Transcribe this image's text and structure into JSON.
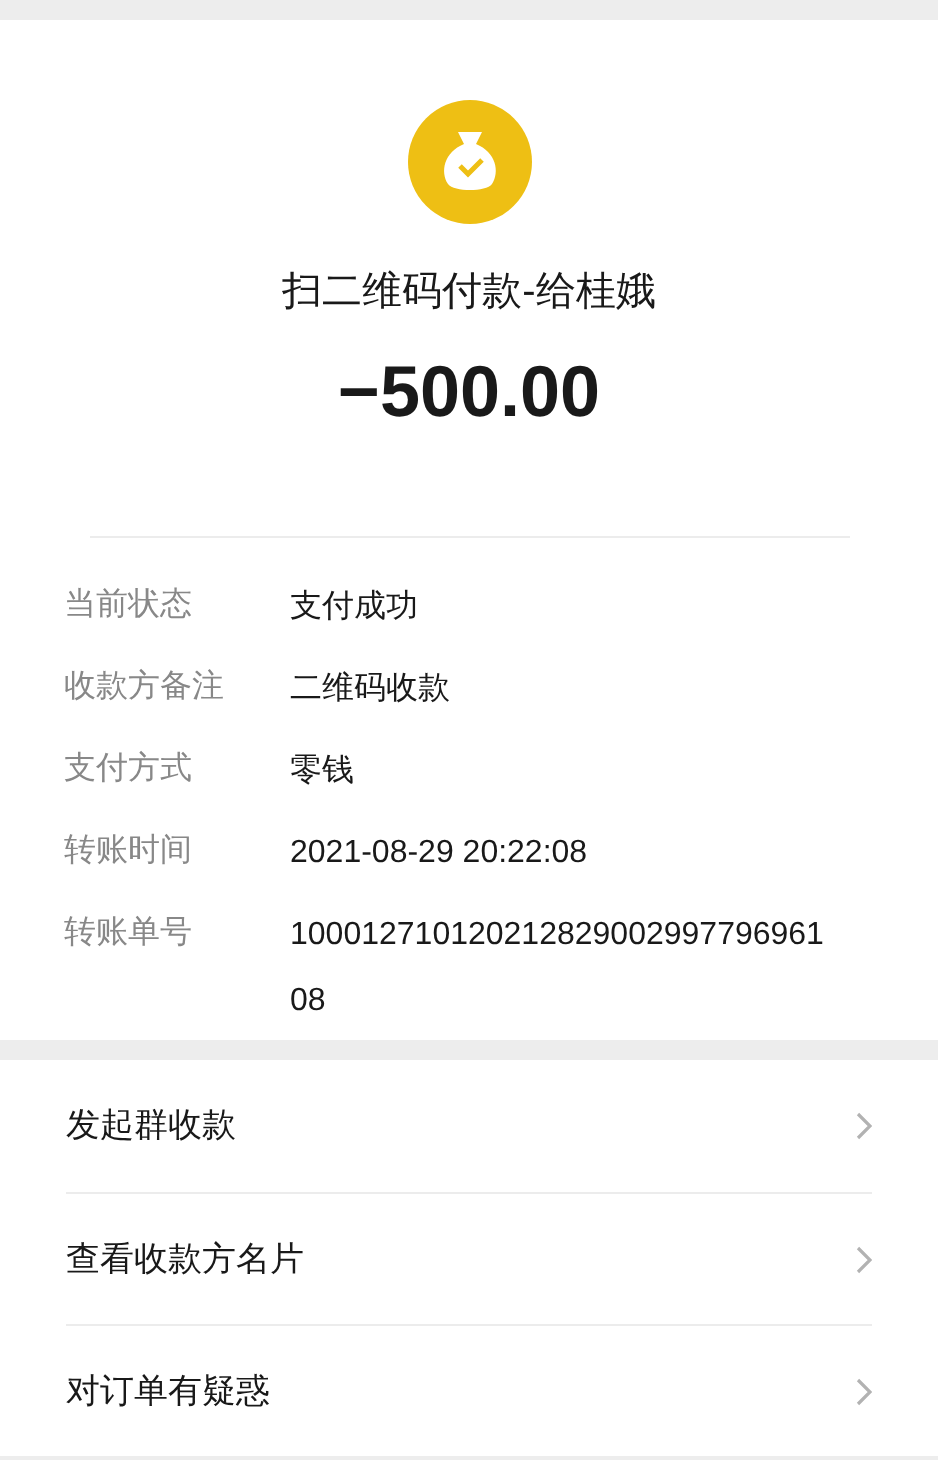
{
  "receipt": {
    "title": "扫二维码付款-给桂娥",
    "amount": "−500.00"
  },
  "details": [
    {
      "label": "当前状态",
      "value": "支付成功"
    },
    {
      "label": "收款方备注",
      "value": "二维码收款"
    },
    {
      "label": "支付方式",
      "value": "零钱"
    },
    {
      "label": "转账时间",
      "value": "2021-08-29 20:22:08"
    },
    {
      "label": "转账单号",
      "value": "10001271012021282900299779696108"
    }
  ],
  "actions": [
    {
      "label": "发起群收款"
    },
    {
      "label": "查看收款方名片"
    },
    {
      "label": "对订单有疑惑"
    }
  ]
}
